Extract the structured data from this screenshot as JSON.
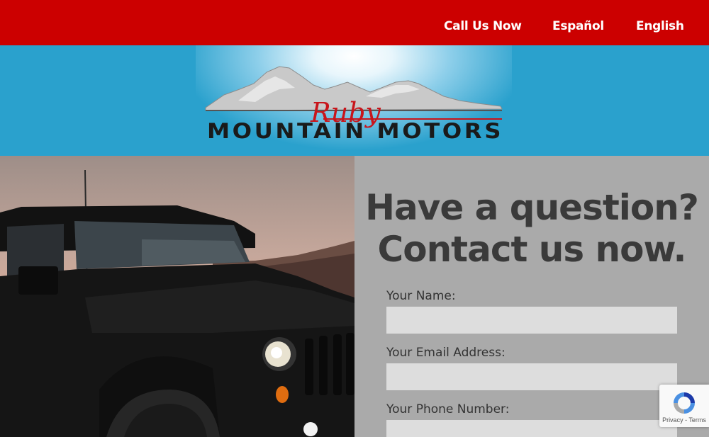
{
  "nav": {
    "call_label": "Call Us Now",
    "spanish_label": "Español",
    "english_label": "English"
  },
  "logo": {
    "script_word": "Ruby",
    "wordmark": "MOUNTAIN MOTORS"
  },
  "contact": {
    "heading_line1": "Have a question?",
    "heading_line2": "Contact us now.",
    "fields": [
      {
        "label": "Your Name:",
        "value": ""
      },
      {
        "label": "Your Email Address:",
        "value": ""
      },
      {
        "label": "Your Phone Number:",
        "value": ""
      }
    ]
  },
  "recaptcha": {
    "privacy_label": "Privacy",
    "separator": " - ",
    "terms_label": "Terms"
  },
  "colors": {
    "topbar": "#cc0000",
    "banner": "#2aa1cd",
    "form_panel": "#aaaaaa",
    "input_bg": "#dddddd",
    "logo_red": "#c8151b"
  }
}
